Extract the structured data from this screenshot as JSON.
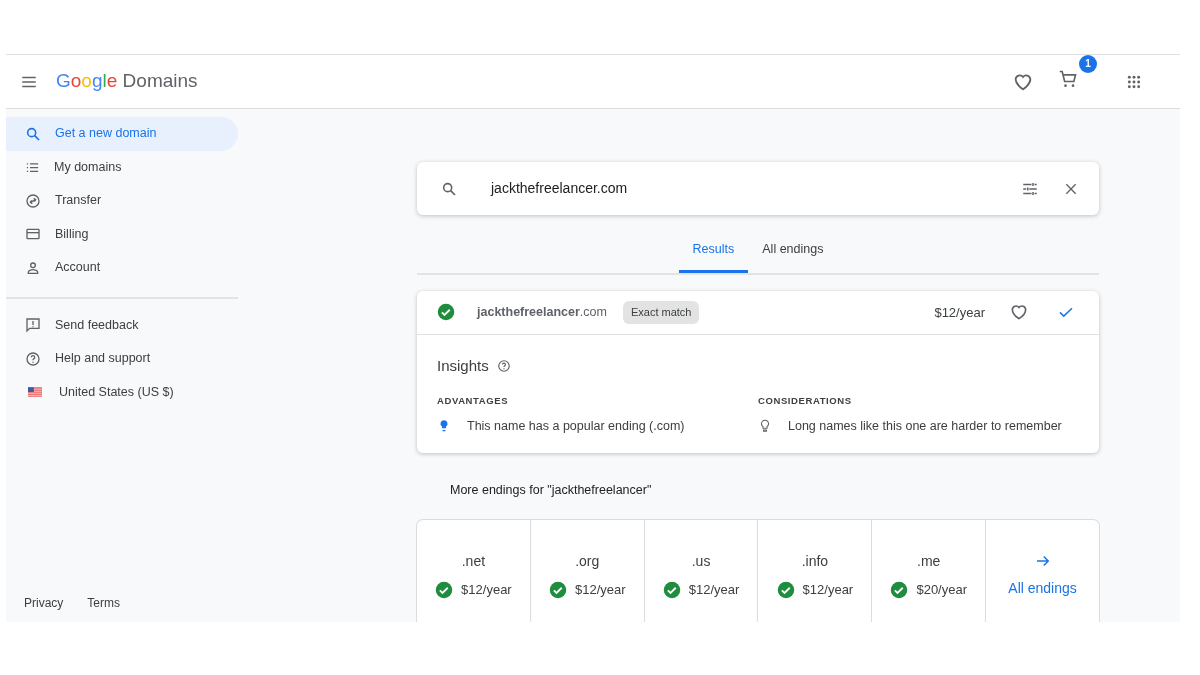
{
  "header": {
    "logo": "Google",
    "product": "Domains",
    "cart_count": "1"
  },
  "sidebar": {
    "items": [
      {
        "label": "Get a new domain",
        "selected": true
      },
      {
        "label": "My domains",
        "selected": false
      },
      {
        "label": "Transfer",
        "selected": false
      },
      {
        "label": "Billing",
        "selected": false
      },
      {
        "label": "Account",
        "selected": false
      }
    ],
    "secondary": [
      {
        "label": "Send feedback"
      },
      {
        "label": "Help and support"
      },
      {
        "label": "United States (US $)"
      }
    ],
    "footer": [
      "Privacy",
      "Terms"
    ]
  },
  "search": {
    "value": "jackthefreelancer.com"
  },
  "tabs": [
    {
      "label": "Results",
      "selected": true
    },
    {
      "label": "All endings",
      "selected": false
    }
  ],
  "result": {
    "name": "**jackthefreelancer**.com",
    "badge": "Exact match",
    "price": "$12/year",
    "available": true,
    "in_cart": true
  },
  "insights": {
    "title": "Insights",
    "advantages": {
      "heading": "ADVANTAGES",
      "text": "This name has a popular ending (.com)"
    },
    "considerations": {
      "heading": "CONSIDERATIONS",
      "text": "Long names like this one are harder to remember"
    }
  },
  "more_endings": {
    "title": "More endings for \"jackthefreelancer\"",
    "items": [
      {
        "ending": ".net",
        "price": "$12/year",
        "available": true
      },
      {
        "ending": ".org",
        "price": "$12/year",
        "available": true
      },
      {
        "ending": ".us",
        "price": "$12/year",
        "available": true
      },
      {
        "ending": ".info",
        "price": "$12/year",
        "available": true
      },
      {
        "ending": ".me",
        "price": "$20/year",
        "available": true
      }
    ],
    "all_link": "All endings"
  }
}
